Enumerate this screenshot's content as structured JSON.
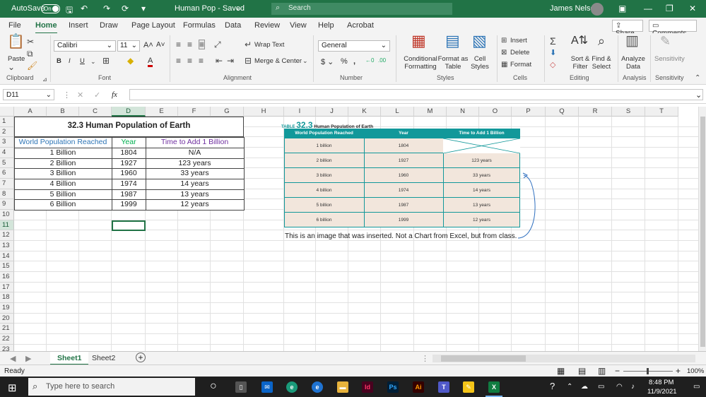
{
  "titlebar": {
    "autosave_label": "AutoSave",
    "autosave_state": "On",
    "doc_title": "Human Pop - Saved",
    "search_placeholder": "Search",
    "user_name": "James Nelson"
  },
  "menu": {
    "items": [
      "File",
      "Home",
      "Insert",
      "Draw",
      "Page Layout",
      "Formulas",
      "Data",
      "Review",
      "View",
      "Help",
      "Acrobat"
    ],
    "active": "Home",
    "share_label": "Share",
    "comments_label": "Comments"
  },
  "ribbon": {
    "paste_label": "Paste",
    "font_name": "Calibri",
    "font_size": "11",
    "wrap_text": "Wrap Text",
    "merge_center": "Merge & Center",
    "number_format": "General",
    "conditional_formatting": "Conditional Formatting",
    "format_as_table": "Format as Table",
    "cell_styles": "Cell Styles",
    "insert": "Insert",
    "delete": "Delete",
    "format": "Format",
    "sort_filter": "Sort & Filter",
    "find_select": "Find & Select",
    "analyze_data": "Analyze Data",
    "sensitivity": "Sensitivity",
    "groups": {
      "clipboard": "Clipboard",
      "font": "Font",
      "alignment": "Alignment",
      "number": "Number",
      "styles": "Styles",
      "cells": "Cells",
      "editing": "Editing",
      "analysis": "Analysis",
      "sensitivity": "Sensitivity"
    }
  },
  "formula_bar": {
    "name_box": "D11",
    "fx_label": "fx",
    "formula": ""
  },
  "grid": {
    "columns": [
      "A",
      "B",
      "C",
      "D",
      "E",
      "F",
      "G",
      "H",
      "I",
      "J",
      "K",
      "L",
      "M",
      "N",
      "O",
      "P",
      "Q",
      "R",
      "S",
      "T"
    ],
    "rows": [
      "1",
      "2",
      "3",
      "4",
      "5",
      "6",
      "7",
      "8",
      "9",
      "10",
      "11",
      "12",
      "13",
      "14",
      "15",
      "16",
      "17",
      "18",
      "19",
      "20",
      "21",
      "22",
      "23"
    ],
    "selected_cell": "D11"
  },
  "table": {
    "title": "32.3 Human Population of Earth",
    "headers": [
      "World Population Reached",
      "Year",
      "Time to Add 1 Billion"
    ],
    "header_colors": [
      "#2e75b6",
      "#00b050",
      "#7030a0"
    ],
    "rows": [
      [
        "1 Billion",
        "1804",
        "N/A"
      ],
      [
        "2 Billion",
        "1927",
        "123 years"
      ],
      [
        "3 Billion",
        "1960",
        "33 years"
      ],
      [
        "4 Billion",
        "1974",
        "14 years"
      ],
      [
        "5 Billion",
        "1987",
        "13 years"
      ],
      [
        "6 Billion",
        "1999",
        "12 years"
      ]
    ]
  },
  "image": {
    "table_tag": "TABLE",
    "table_number": "32.3",
    "title": "Human Population of Earth",
    "headers": [
      "World Population Reached",
      "Year",
      "Time to Add 1 Billion"
    ],
    "rows": [
      [
        "1 billion",
        "1804",
        ""
      ],
      [
        "2 billion",
        "1927",
        "123 years"
      ],
      [
        "3 billion",
        "1960",
        "33 years"
      ],
      [
        "4 billion",
        "1974",
        "14 years"
      ],
      [
        "5 billion",
        "1987",
        "13 years"
      ],
      [
        "6 billion",
        "1999",
        "12 years"
      ]
    ],
    "accent_color": "#12989a",
    "row_color": "#f2e6dc"
  },
  "annotation": "This is an image that was inserted. Not a Chart from Excel, but from class.",
  "sheets": {
    "tabs": [
      "Sheet1",
      "Sheet2"
    ],
    "active": "Sheet1"
  },
  "status": {
    "ready": "Ready",
    "zoom": "100%"
  },
  "taskbar": {
    "search_placeholder": "Type here to search",
    "time": "8:48 PM",
    "date": "11/9/2021",
    "app_id": "Id",
    "app_ps": "Ps",
    "app_ai": "Ai",
    "app_teams": "T",
    "app_excel": "X"
  }
}
